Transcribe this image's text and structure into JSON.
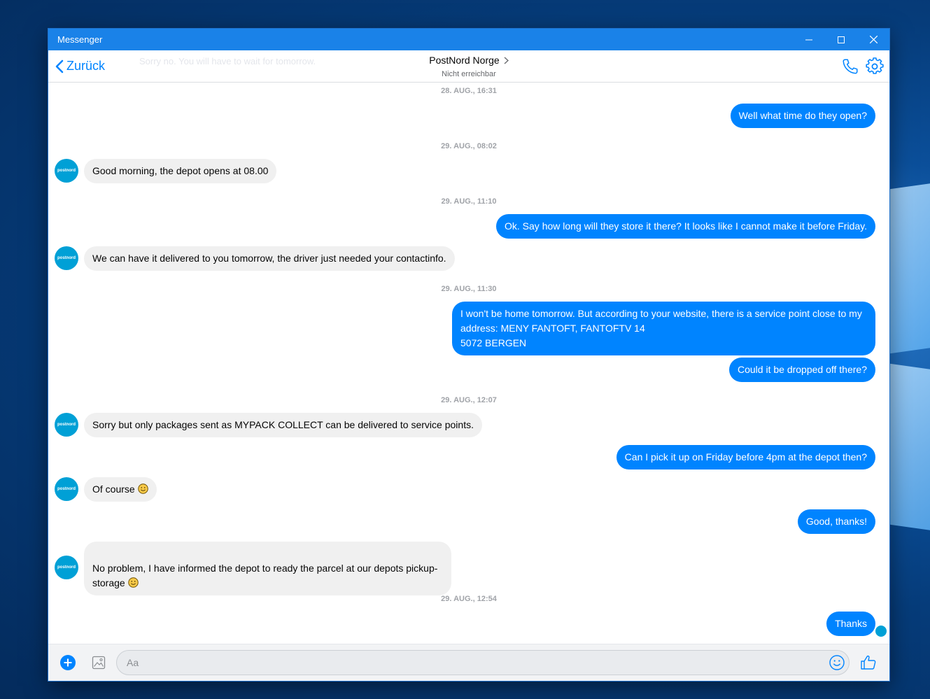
{
  "window": {
    "title": "Messenger"
  },
  "header": {
    "back_label": "Zurück",
    "ghost_text": "Sorry no. You will have to wait for tomorrow.",
    "contact_name": "PostNord Norge",
    "contact_status": "Nicht erreichbar"
  },
  "avatar_label": "postnord",
  "timestamps": [
    "28. AUG., 16:31",
    "29. AUG., 08:02",
    "29. AUG., 11:10",
    "29. AUG., 11:30",
    "29. AUG., 12:07",
    "29. AUG., 12:54"
  ],
  "messages": [
    {
      "dir": "out",
      "text": "Well what time do they open?"
    },
    {
      "dir": "in",
      "text": "Good morning, the depot opens at 08.00"
    },
    {
      "dir": "out",
      "text": "Ok. Say how long will they store it there? It looks like I cannot make it before Friday."
    },
    {
      "dir": "in",
      "text": "We can have it delivered to you tomorrow, the driver just needed your contactinfo."
    },
    {
      "dir": "out",
      "text": "I won't be home tomorrow. But according to your website, there is a service point close to my\naddress: MENY FANTOFT, FANTOFTV 14\n5072 BERGEN"
    },
    {
      "dir": "out",
      "text": "Could it be dropped off there?"
    },
    {
      "dir": "in",
      "text": "Sorry but only packages sent as MYPACK COLLECT can be delivered to service points."
    },
    {
      "dir": "out",
      "text": "Can I pick it up on Friday before 4pm at the depot then?"
    },
    {
      "dir": "in",
      "text": "Of course "
    },
    {
      "dir": "out",
      "text": "Good, thanks!"
    },
    {
      "dir": "in",
      "text": "No problem, I have informed the depot to ready the parcel at our depots pickup-\nstorage "
    },
    {
      "dir": "out",
      "text": "Thanks"
    }
  ],
  "composer": {
    "placeholder": "Aa"
  },
  "colors": {
    "accent": "#0084ff",
    "titlebar": "#1a82e8",
    "incoming_bubble": "#f0f0f0",
    "avatar": "#00a0d6"
  }
}
